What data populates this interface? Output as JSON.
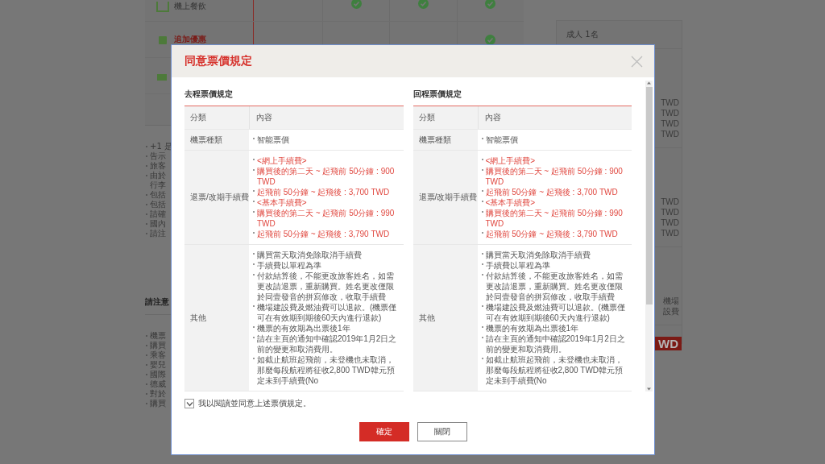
{
  "background": {
    "services": [
      {
        "label": "機上餐飲",
        "highlight": false,
        "checks": [
          {
            "included": true
          },
          {
            "included": true
          },
          {
            "included": true
          }
        ]
      },
      {
        "label": "追加優惠",
        "highlight": true,
        "checks": [
          {
            "included": false
          },
          {
            "included": false
          },
          {
            "included": true
          }
        ]
      }
    ],
    "notes": [
      {
        "lines": [
          "+1 是"
        ]
      },
      {
        "lines": [
          "告示"
        ]
      },
      {
        "lines": [
          "旅客"
        ]
      },
      {
        "lines": [
          "由於",
          "行李"
        ]
      },
      {
        "lines": [
          "包括"
        ]
      },
      {
        "lines": [
          "包括"
        ]
      },
      {
        "lines": [
          "請確"
        ]
      },
      {
        "lines": [
          "國內"
        ]
      },
      {
        "lines": [
          "請注"
        ]
      }
    ],
    "notice_title": "請注意",
    "notice_items": [
      "機票",
      "購買",
      "乘客",
      "嬰兒",
      "國際",
      "德威",
      "對於",
      "購買"
    ],
    "summary": {
      "passengers": "成人 1名",
      "groups": [
        {
          "lines": [
            "TWD",
            "TWD",
            "TWD",
            "TWD"
          ]
        },
        {
          "lines": [
            "TWD",
            "TWD",
            "TWD",
            "TWD"
          ]
        },
        {
          "lines": [
            "機場",
            "設費"
          ]
        }
      ],
      "total": "WD"
    }
  },
  "dialog": {
    "title": "同意票價規定",
    "sections": [
      {
        "title": "去程票價規定",
        "columns": [
          "分類",
          "內容"
        ],
        "rows": [
          {
            "category": "機票種類",
            "items": [
              {
                "kind": "plain",
                "text": "智能票價"
              }
            ]
          },
          {
            "category": "退票/改期手續費",
            "items": [
              {
                "kind": "fee",
                "text": "<網上手續費>"
              },
              {
                "kind": "fee",
                "text": "購買後的第二天 ~ 起飛前 50分鐘 : 900 TWD"
              },
              {
                "kind": "fee",
                "text": "起飛前 50分鐘 ~ 起飛後 : 3,700 TWD"
              },
              {
                "kind": "fee",
                "text": "<基本手續費>"
              },
              {
                "kind": "fee",
                "text": "購買後的第二天 ~ 起飛前 50分鐘 : 990 TWD"
              },
              {
                "kind": "fee",
                "text": "起飛前 50分鐘 ~ 起飛後 : 3,790 TWD"
              }
            ]
          },
          {
            "category": "其他",
            "items": [
              {
                "kind": "plain",
                "text": "購買當天取消免除取消手續費"
              },
              {
                "kind": "plain",
                "text": "手續費以單程為準"
              },
              {
                "kind": "plain",
                "text": "付款結算後，不能更改旅客姓名，如需更改請退票，重新購買。姓名更改僅限於同壹發音的拼寫修改，收取手續費"
              },
              {
                "kind": "plain",
                "text": "機場建設費及燃油費可以退款。(機票僅可在有效期到期後60天內進行退款)"
              },
              {
                "kind": "plain",
                "text": "機票的有效期為出票後1年"
              },
              {
                "kind": "plain",
                "text": "請在主頁的通知中確認2019年1月2日之前的變更和取消費用。"
              },
              {
                "kind": "plain",
                "text": "如截止航班起飛前，未登機也未取消，那麼每段航程將征收2,800 TWD韓元預定未到手續費(No"
              }
            ]
          }
        ]
      },
      {
        "title": "回程票價規定",
        "columns": [
          "分類",
          "內容"
        ],
        "rows": [
          {
            "category": "機票種類",
            "items": [
              {
                "kind": "plain",
                "text": "智能票價"
              }
            ]
          },
          {
            "category": "退票/改期手續費",
            "items": [
              {
                "kind": "fee",
                "text": "<網上手續費>"
              },
              {
                "kind": "fee",
                "text": "購買後的第二天 ~ 起飛前 50分鐘 : 900 TWD"
              },
              {
                "kind": "fee",
                "text": "起飛前 50分鐘 ~ 起飛後 : 3,700 TWD"
              },
              {
                "kind": "fee",
                "text": "<基本手續費>"
              },
              {
                "kind": "fee",
                "text": "購買後的第二天 ~ 起飛前 50分鐘 : 990 TWD"
              },
              {
                "kind": "fee",
                "text": "起飛前 50分鐘 ~ 起飛後 : 3,790 TWD"
              }
            ]
          },
          {
            "category": "其他",
            "items": [
              {
                "kind": "plain",
                "text": "購買當天取消免除取消手續費"
              },
              {
                "kind": "plain",
                "text": "手續費以單程為準"
              },
              {
                "kind": "plain",
                "text": "付款結算後，不能更改旅客姓名，如需更改請退票，重新購買。姓名更改僅限於同壹發音的拼寫修改，收取手續費"
              },
              {
                "kind": "plain",
                "text": "機場建設費及燃油費可以退款。(機票僅可在有效期到期後60天內進行退款)"
              },
              {
                "kind": "plain",
                "text": "機票的有效期為出票後1年"
              },
              {
                "kind": "plain",
                "text": "請在主頁的通知中確認2019年1月2日之前的變更和取消費用。"
              },
              {
                "kind": "plain",
                "text": "如截止航班起飛前，未登機也未取消，那麼每段航程將征收2,800 TWD韓元預定未到手續費(No"
              }
            ]
          }
        ]
      }
    ],
    "agreement": {
      "label": "我以閱讀並同意上述票價規定。",
      "checked": true
    },
    "buttons": [
      {
        "label": "確定",
        "kind": "primary"
      },
      {
        "label": "關閉",
        "kind": "secondary"
      }
    ]
  }
}
